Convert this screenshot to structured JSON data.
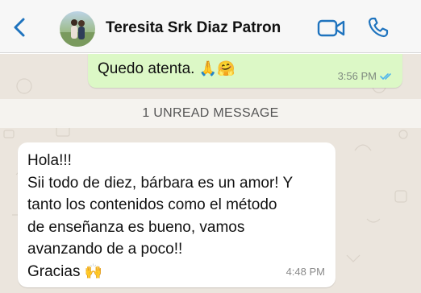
{
  "header": {
    "contact_name": "Teresita Srk Diaz Patron",
    "icons": {
      "back": "chevron-left-icon",
      "video": "video-camera-icon",
      "call": "phone-icon"
    },
    "accent_color": "#1e73be"
  },
  "messages": {
    "outgoing": {
      "text": "Quedo atenta.",
      "emojis": "🙏🤗",
      "time": "3:56 PM",
      "status_icon": "double-check-icon"
    },
    "unread_banner": "1 UNREAD MESSAGE",
    "incoming": {
      "lines": [
        "Hola!!!",
        "Sii todo de diez, bárbara es un amor! Y",
        "tanto los contenidos como el método",
        "de enseñanza es bueno, vamos",
        "avanzando de a poco!!",
        "Gracias"
      ],
      "emoji": "🙌",
      "time": "4:48 PM"
    }
  },
  "colors": {
    "outgoing_bubble": "#dcf8c6",
    "incoming_bubble": "#ffffff",
    "chat_background": "#ebe5dd",
    "read_receipt": "#4fb6ec"
  }
}
